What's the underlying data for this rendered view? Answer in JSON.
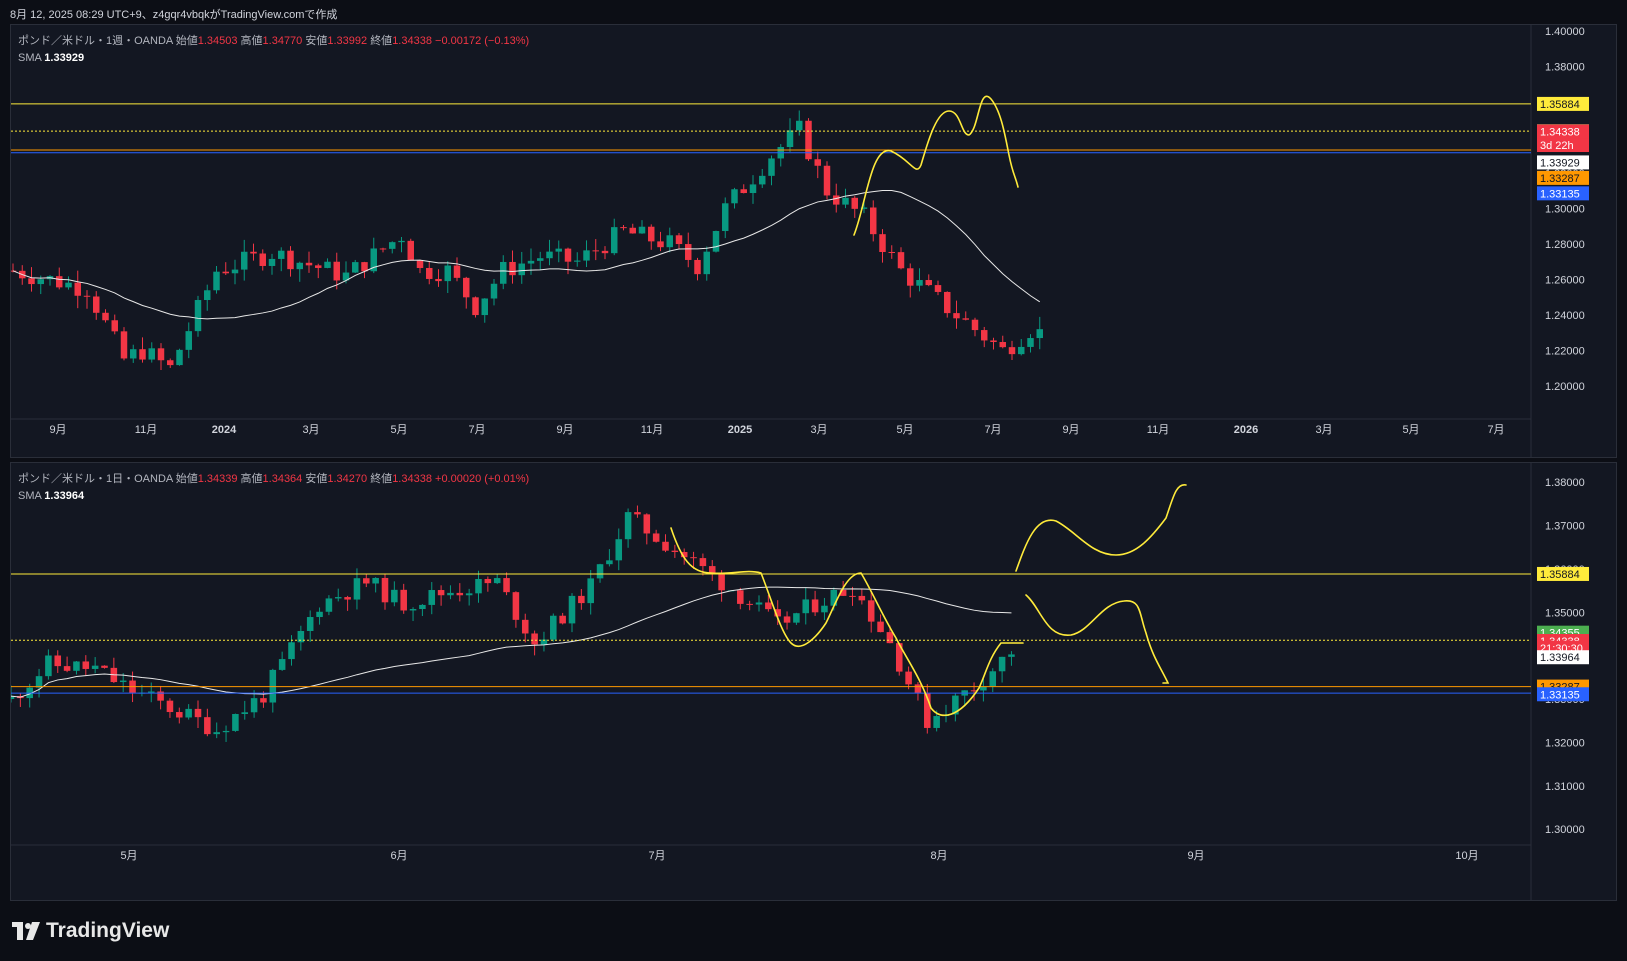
{
  "screenshot_caption": "8月 12, 2025 08:29 UTC+9、z4gqr4vbqkがTradingView.comで作成",
  "brand": {
    "name": "TradingView"
  },
  "colors": {
    "up": "#089981",
    "down": "#f23645",
    "sma": "#e8e8e8",
    "drawing": "#ffeb3b",
    "level_yellow": "#ffeb3b",
    "level_orange": "#ff9800",
    "level_blue": "#2962ff",
    "level_red": "#f23645"
  },
  "weekly": {
    "symbol": "ポンド／米ドル・1週・OANDA",
    "ohlc": {
      "open_label": "始値",
      "open": "1.34503",
      "high_label": "高値",
      "high": "1.34770",
      "low_label": "安値",
      "low": "1.33992",
      "close_label": "終値",
      "close": "1.34338",
      "change": "−0.00172 (−0.13%)"
    },
    "sma": {
      "label": "SMA",
      "value": "1.33929"
    },
    "price_axis": [
      "1.40000",
      "1.38000",
      "1.36000",
      "1.34000",
      "1.32000",
      "1.30000",
      "1.28000",
      "1.26000",
      "1.24000",
      "1.22000",
      "1.20000"
    ],
    "price_labels": [
      {
        "text": "1.35884",
        "price": 1.35884,
        "bg": "#ffeb3b",
        "fg": "#131722"
      },
      {
        "text": "1.34355",
        "price": 1.34355,
        "bg": "#4caf50",
        "fg": "#ffffff"
      },
      {
        "text": "1.34338",
        "price": 1.34338,
        "bg": "#f23645",
        "fg": "#ffffff"
      },
      {
        "text": "3d 22h",
        "price": 1.3357,
        "bg": "#f23645",
        "fg": "#ffffff"
      },
      {
        "text": "1.33929",
        "price": 1.3259,
        "bg": "#ffffff",
        "fg": "#131722"
      },
      {
        "text": "1.33287",
        "price": 1.3172,
        "bg": "#ff9800",
        "fg": "#131722"
      },
      {
        "text": "1.33135",
        "price": 1.3085,
        "bg": "#2962ff",
        "fg": "#ffffff"
      }
    ],
    "levels": [
      {
        "price": 1.35884,
        "color": "#ffeb3b"
      },
      {
        "price": 1.34355,
        "color": "#ffeb3b",
        "dotted": true
      },
      {
        "price": 1.33287,
        "color": "#ff9800"
      },
      {
        "price": 1.33135,
        "color": "#2962ff"
      }
    ],
    "time_axis": [
      "9月",
      "11月",
      "2024",
      "3月",
      "5月",
      "7月",
      "9月",
      "11月",
      "2025",
      "3月",
      "5月",
      "7月",
      "9月",
      "11月",
      "2026",
      "3月",
      "5月",
      "7月"
    ]
  },
  "daily": {
    "symbol": "ポンド／米ドル・1日・OANDA",
    "ohlc": {
      "open_label": "始値",
      "open": "1.34339",
      "high_label": "高値",
      "high": "1.34364",
      "low_label": "安値",
      "low": "1.34270",
      "close_label": "終値",
      "close": "1.34338",
      "change": "+0.00020 (+0.01%)"
    },
    "sma": {
      "label": "SMA",
      "value": "1.33964"
    },
    "price_axis": [
      "1.38000",
      "1.37000",
      "1.36000",
      "1.35000",
      "1.34000",
      "1.33000",
      "1.32000",
      "1.31000",
      "1.30000"
    ],
    "price_labels": [
      {
        "text": "1.35884",
        "price": 1.35884,
        "bg": "#ffeb3b",
        "fg": "#131722"
      },
      {
        "text": "1.34355",
        "price": 1.3453,
        "bg": "#4caf50",
        "fg": "#ffffff"
      },
      {
        "text": "1.34338",
        "price": 1.34338,
        "bg": "#f23645",
        "fg": "#ffffff"
      },
      {
        "text": "21:30:30",
        "price": 1.3418,
        "bg": "#f23645",
        "fg": "#ffffff"
      },
      {
        "text": "1.33964",
        "price": 1.33964,
        "bg": "#ffffff",
        "fg": "#131722"
      },
      {
        "text": "1.33287",
        "price": 1.33287,
        "bg": "#ff9800",
        "fg": "#131722"
      },
      {
        "text": "1.33135",
        "price": 1.3311,
        "bg": "#2962ff",
        "fg": "#ffffff"
      }
    ],
    "levels": [
      {
        "price": 1.35884,
        "color": "#ffeb3b"
      },
      {
        "price": 1.34355,
        "color": "#ffeb3b",
        "dotted": true
      },
      {
        "price": 1.33287,
        "color": "#ff9800"
      },
      {
        "price": 1.33135,
        "color": "#2962ff"
      }
    ],
    "time_axis": [
      "5月",
      "6月",
      "7月",
      "8月",
      "9月",
      "10月"
    ]
  }
}
